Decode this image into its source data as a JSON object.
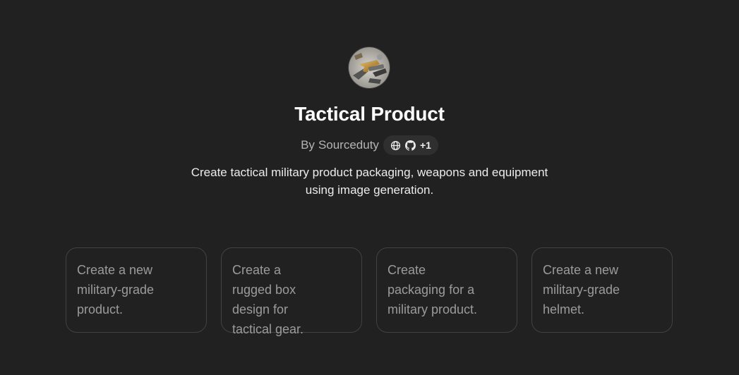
{
  "gpt": {
    "avatar_icon": "tactical-gear-image",
    "title": "Tactical Product",
    "by_prefix": "By",
    "author": "Sourceduty",
    "links": {
      "icons": [
        "globe-icon",
        "github-icon"
      ],
      "extra_count": "+1"
    },
    "description": "Create tactical military product packaging, weapons and equipment using image generation."
  },
  "conversation_starters": [
    {
      "label": "Create a new military-grade product."
    },
    {
      "label": "Create a rugged box design for tactical gear."
    },
    {
      "label": "Create packaging for a military product."
    },
    {
      "label": "Create a new military-grade helmet."
    }
  ],
  "colors": {
    "background": "#212121",
    "card_border": "#424242",
    "pill_bg": "#2f2f2f",
    "muted_text": "#9b9b9b"
  }
}
